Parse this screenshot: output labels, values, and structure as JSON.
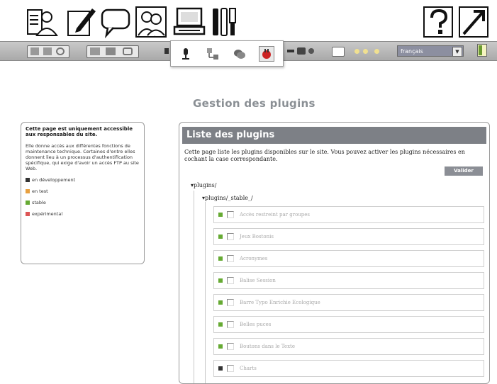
{
  "top_icons": [
    {
      "name": "visitor-icon"
    },
    {
      "name": "edit-icon"
    },
    {
      "name": "forum-icon"
    },
    {
      "name": "users-icon"
    },
    {
      "name": "admin-computer-icon"
    },
    {
      "name": "tools-icon"
    },
    {
      "name": "help-icon"
    },
    {
      "name": "exit-icon"
    }
  ],
  "toolbar": {
    "language": "français",
    "language_arrow": "▼"
  },
  "page": {
    "title": "Gestion des plugins"
  },
  "infobox": {
    "title": "Cette page est uniquement accessible aux responsables du site.",
    "text": "Elle donne accès aux différentes fonctions de maintenance technique. Certaines d'entre elles donnent lieu à un processus d'authentification spécifique, qui exige d'avoir un accès FTP au site Web.",
    "legend": [
      {
        "label": "en développement",
        "color": "#333333"
      },
      {
        "label": "en test",
        "color": "#e8a040"
      },
      {
        "label": "stable",
        "color": "#66aa33"
      },
      {
        "label": "expérimental",
        "color": "#dd5555"
      }
    ]
  },
  "panel": {
    "heading": "Liste des plugins",
    "description": "Cette page liste les plugins disponibles sur le site. Vous pouvez activer les plugins nécessaires en cochant la case correspondante.",
    "validate_label": "Valider",
    "tree_root": "▾plugins/",
    "tree_sub": "▾plugins/_stable_/",
    "plugins": [
      {
        "name": "Accès restreint par groupes",
        "status_color": "#66aa33"
      },
      {
        "name": "Jeux Bostonis",
        "status_color": "#66aa33"
      },
      {
        "name": "Acronymes",
        "status_color": "#66aa33"
      },
      {
        "name": "Balise Session",
        "status_color": "#66aa33"
      },
      {
        "name": "Barre Typo Enrichie Ecologique",
        "status_color": "#66aa33"
      },
      {
        "name": "Belles puces",
        "status_color": "#66aa33"
      },
      {
        "name": "Boutons dans le Texte",
        "status_color": "#66aa33"
      },
      {
        "name": "Charts",
        "status_color": "#333333"
      }
    ]
  }
}
